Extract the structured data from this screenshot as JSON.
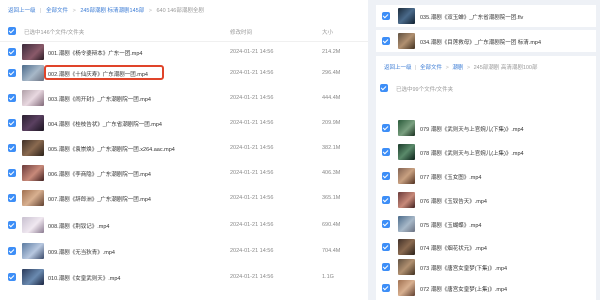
{
  "left": {
    "breadcrumb": {
      "back": "返回上一级",
      "items": [
        "全部文件",
        "245部潮剧 标清潮剧145部",
        "640 146部潮剧全剧"
      ]
    },
    "header": {
      "selected": "已选中146个文件/文件夹",
      "col_time": "修改时间",
      "col_size": "大小"
    },
    "rows": [
      {
        "name": "001.潮剧《杨令婆辩本》广东一团.mp4",
        "time": "2024-01-21 14:56",
        "size": "214.2M"
      },
      {
        "name": "002.潮剧《十仙庆寿》广东潮剧一团.mp4",
        "time": "2024-01-21 14:56",
        "size": "296.4M"
      },
      {
        "name": "003.潮剧《闹开封》_广东潮剧院一团.mp4",
        "time": "2024-01-21 14:56",
        "size": "444.4M"
      },
      {
        "name": "004.潮剧《桂枝告状》_广东省潮剧院一团.mp4",
        "time": "2024-01-21 14:56",
        "size": "209.9M"
      },
      {
        "name": "005.潮剧《袁崇焕》_广东潮剧院一团.x264.aac.mp4",
        "time": "2024-01-21 14:56",
        "size": "382.1M"
      },
      {
        "name": "006.潮剧《李商隐》_广东潮剧院一团.mp4",
        "time": "2024-01-21 14:56",
        "size": "406.3M"
      },
      {
        "name": "007.潮剧《辞郎洲》_广东潮剧院一团.mp4",
        "time": "2024-01-21 14:56",
        "size": "365.1M"
      },
      {
        "name": "008.潮剧《荆钗记》.mp4",
        "time": "2024-01-21 14:56",
        "size": "690.4M"
      },
      {
        "name": "009.潮剧《无当狄青》.mp4",
        "time": "2024-01-21 14:56",
        "size": "704.4M"
      },
      {
        "name": "010.潮剧《女皇武则天》.mp4",
        "time": "2024-01-21 14:56",
        "size": "1.1G"
      }
    ]
  },
  "right": {
    "top_rows": [
      {
        "name": "035.潮剧《双玉蝉》_广东省潮剧院一团.flv"
      },
      {
        "name": "034.潮剧《目莲救母》_广东潮剧院一团 标清.mp4"
      }
    ],
    "breadcrumb": {
      "back": "返回上一级",
      "items": [
        "全部文件",
        "潮剧",
        "245部潮剧 高清潮剧100部"
      ]
    },
    "header": {
      "selected": "已选中99个文件/文件夹"
    },
    "rows": [
      {
        "name": "079 潮剧《武则天与上官婉儿(下集)》.mp4"
      },
      {
        "name": "078 潮剧《武则天与上官婉儿(上集)》.mp4"
      },
      {
        "name": "077 潮剧《玉女图》.mp4"
      },
      {
        "name": "076 潮剧《玉钗告天》.mp4"
      },
      {
        "name": "075 潮剧《玉蝴蝶》.mp4"
      },
      {
        "name": "074 潮剧《烟花状元》.mp4"
      },
      {
        "name": "073 潮剧《唐宫女皇梦(下集)》.mp4"
      },
      {
        "name": "072 潮剧《唐宫女皇梦(上集)》.mp4"
      }
    ]
  },
  "colors": {
    "accent": "#3d8ef7",
    "highlight": "#e0442a"
  }
}
